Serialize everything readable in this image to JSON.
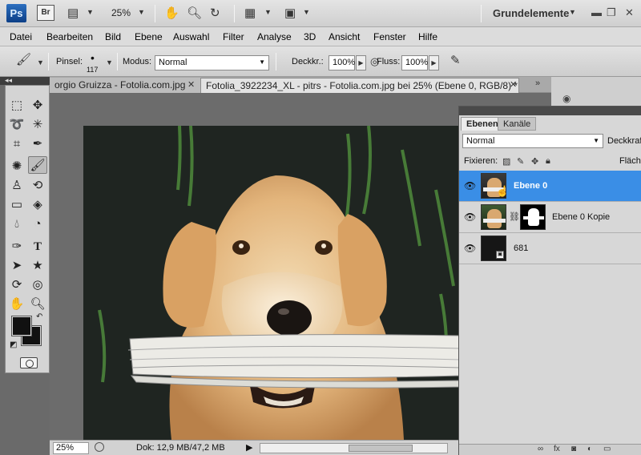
{
  "app": {
    "logo": "Ps",
    "bridge": "Br",
    "zoom": "25%",
    "workspace": "Grundelemente"
  },
  "menu": [
    "Datei",
    "Bearbeiten",
    "Bild",
    "Ebene",
    "Auswahl",
    "Filter",
    "Analyse",
    "3D",
    "Ansicht",
    "Fenster",
    "Hilfe"
  ],
  "options": {
    "brush_label": "Pinsel:",
    "brush_size": "117",
    "mode_label": "Modus:",
    "mode_value": "Normal",
    "opacity_label": "Deckkr.:",
    "opacity_value": "100%",
    "flow_label": "Fluss:",
    "flow_value": "100%"
  },
  "tabs": [
    {
      "label": "orgio Gruizza - Fotolia.com.jpg"
    },
    {
      "label": "Fotolia_3922234_XL - pitrs - Fotolia.com.jpg bei 25% (Ebene 0, RGB/8) *"
    }
  ],
  "tab_more": "»",
  "status": {
    "zoom": "25%",
    "doc": "Dok: 12,9 MB/47,2 MB"
  },
  "layers_panel": {
    "tab_layers": "Ebenen",
    "tab_channels": "Kanäle",
    "blend_mode": "Normal",
    "opacity_label": "Deckkraft",
    "lock_label": "Fixieren:",
    "fill_label": "Fläche",
    "layers": [
      {
        "name": "Ebene 0",
        "selected": true
      },
      {
        "name": "Ebene 0 Kopie",
        "selected": false
      },
      {
        "name": "681",
        "selected": false
      }
    ]
  },
  "colors": {
    "selection": "#3a8ee6",
    "foreground": "#111111",
    "background": "#111111"
  }
}
